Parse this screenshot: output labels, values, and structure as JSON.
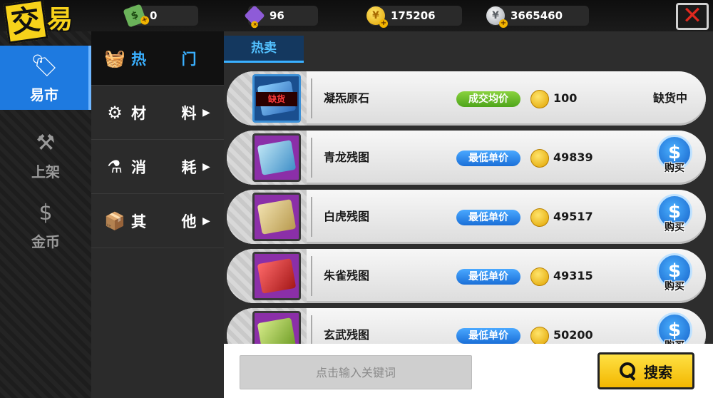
{
  "title": {
    "char1": "交",
    "rest": "易"
  },
  "resources": [
    {
      "icon": "cash-icon",
      "value": "0"
    },
    {
      "icon": "gem-icon",
      "value": "96"
    },
    {
      "icon": "gold-coin-icon",
      "value": "175206"
    },
    {
      "icon": "silver-coin-icon",
      "value": "3665460"
    }
  ],
  "close_icon": "✕",
  "sidenav": [
    {
      "label": "易市",
      "icon": "tag-icon",
      "active": true
    },
    {
      "label": "上架",
      "icon": "gavel-icon",
      "active": false
    },
    {
      "label": "金币",
      "icon": "coin-icon",
      "active": false
    }
  ],
  "categories": [
    {
      "l1": "热",
      "l2": "门",
      "icon": "basket-icon",
      "active": true,
      "arrow": ""
    },
    {
      "l1": "材",
      "l2": "料",
      "icon": "gear-icon",
      "active": false,
      "arrow": "▶"
    },
    {
      "l1": "消",
      "l2": "耗",
      "icon": "potion-icon",
      "active": false,
      "arrow": "▶"
    },
    {
      "l1": "其",
      "l2": "他",
      "icon": "box-icon",
      "active": false,
      "arrow": "▶"
    }
  ],
  "tab": {
    "label": "热卖"
  },
  "items": [
    {
      "name": "凝炁原石",
      "price_label": "成交均价",
      "price_color": "green",
      "price": "100",
      "status": "缺货中",
      "oos_label": "缺货",
      "thumb_color": "#2a67b8",
      "thumb_border": "#3b8fd6",
      "buy_label": ""
    },
    {
      "name": "青龙残图",
      "price_label": "最低单价",
      "price_color": "blue",
      "price": "49839",
      "status": "",
      "oos_label": "",
      "thumb_color": "#69b6d8",
      "thumb_border": "#a24ac0",
      "buy_label": "购买"
    },
    {
      "name": "白虎残图",
      "price_label": "最低单价",
      "price_color": "blue",
      "price": "49517",
      "status": "",
      "oos_label": "",
      "thumb_color": "#d8c489",
      "thumb_border": "#a24ac0",
      "buy_label": "购买"
    },
    {
      "name": "朱雀残图",
      "price_label": "最低单价",
      "price_color": "blue",
      "price": "49315",
      "status": "",
      "oos_label": "",
      "thumb_color": "#c92f2f",
      "thumb_border": "#a24ac0",
      "buy_label": "购买"
    },
    {
      "name": "玄武残图",
      "price_label": "最低单价",
      "price_color": "blue",
      "price": "50200",
      "status": "",
      "oos_label": "",
      "thumb_color": "#9bbd4a",
      "thumb_border": "#a24ac0",
      "buy_label": "购买"
    }
  ],
  "search": {
    "placeholder": "点击输入关键词",
    "button_label": "搜索"
  },
  "colors": {
    "accent": "#1e7ae0",
    "tab_text": "#53c1ff",
    "search_button": "#f7c400"
  }
}
